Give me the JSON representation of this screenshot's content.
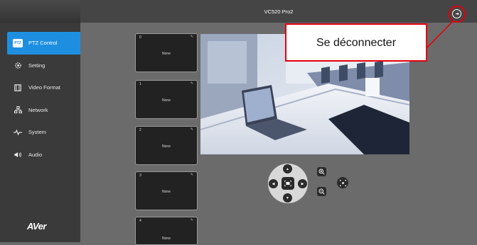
{
  "header": {
    "title": "VC520 Pro2"
  },
  "sidebar": {
    "items": [
      {
        "label": "PTZ Control",
        "icon": "ptz-icon",
        "badge": "PTZ"
      },
      {
        "label": "Setting",
        "icon": "gear-icon"
      },
      {
        "label": "Video Format",
        "icon": "film-icon"
      },
      {
        "label": "Network",
        "icon": "network-icon"
      },
      {
        "label": "System",
        "icon": "pulse-icon"
      },
      {
        "label": "Audio",
        "icon": "speaker-icon"
      }
    ],
    "brand": "AVer"
  },
  "presets": [
    {
      "number": "0",
      "label": "None"
    },
    {
      "number": "1",
      "label": "None"
    },
    {
      "number": "2",
      "label": "None"
    },
    {
      "number": "3",
      "label": "None"
    },
    {
      "number": "4",
      "label": "None"
    }
  ],
  "callout": {
    "text": "Se déconnecter"
  },
  "colors": {
    "accent": "#1e8fe0",
    "callout_border": "#e3000f",
    "sidebar": "#3a3a3a",
    "topbar": "#454545"
  }
}
